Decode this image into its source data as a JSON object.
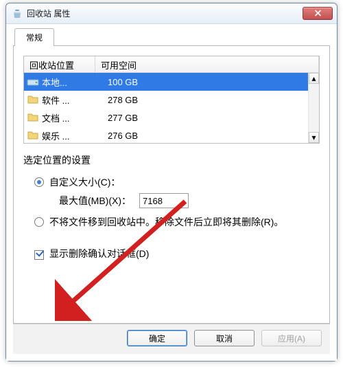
{
  "title": "回收站 属性",
  "tab": {
    "label": "常规"
  },
  "list": {
    "headers": [
      "回收站位置",
      "可用空间"
    ],
    "rows": [
      {
        "name": "本地...",
        "space": "100 GB",
        "selected": true
      },
      {
        "name": "软件 ...",
        "space": "278 GB",
        "selected": false
      },
      {
        "name": "文档 ...",
        "space": "277 GB",
        "selected": false
      },
      {
        "name": "娱乐 ...",
        "space": "276 GB",
        "selected": false
      }
    ]
  },
  "group_label": "选定位置的设置",
  "radio_custom": {
    "label": "自定义大小(C)：",
    "checked": true
  },
  "max_label": "最大值(MB)(X)：",
  "max_value": "7168",
  "radio_nobin": {
    "label": "不将文件移到回收站中。移除文件后立即将其删除(R)。",
    "checked": false
  },
  "checkbox_confirm": {
    "label": "显示删除确认对话框(D)",
    "checked": true
  },
  "buttons": {
    "ok": "确定",
    "cancel": "取消",
    "apply": "应用(A)"
  },
  "colors": {
    "selection": "#2f7ae5",
    "arrow": "#d21f1f"
  }
}
